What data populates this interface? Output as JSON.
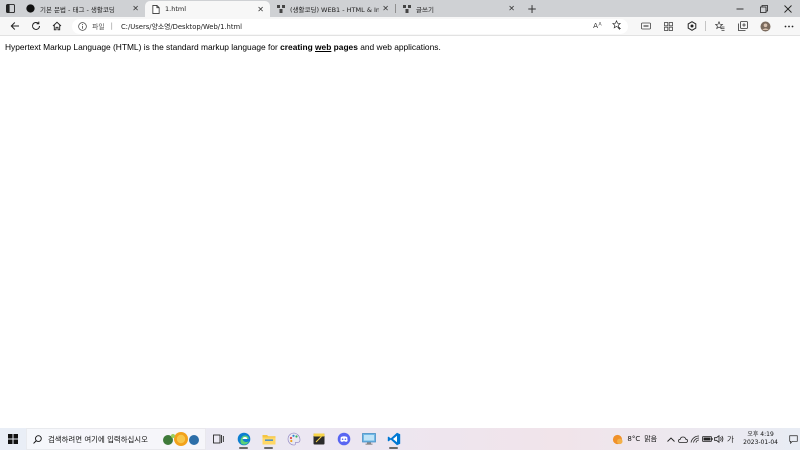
{
  "browser": {
    "tabs": [
      {
        "title": "기본 문법 - 태그 - 생활코딩",
        "icon": "github-icon",
        "active": false
      },
      {
        "title": "1.html",
        "icon": "file-icon",
        "active": true
      },
      {
        "title": "(생활코딩) WEB1 - HTML & Inter",
        "icon": "opentutorials-icon",
        "active": false
      },
      {
        "title": "글쓰기",
        "icon": "opentutorials-icon",
        "active": false
      }
    ],
    "close_glyph": "✕",
    "new_tab_glyph": "+",
    "address": {
      "scheme_label": "파일",
      "divider": "|",
      "url": "C:/Users/양소영/Desktop/Web/1.html"
    }
  },
  "page": {
    "text_before": "Hypertext Markup Language (HTML) is the standard markup language for ",
    "bold_1": "creating",
    "space_1": " ",
    "underline_bold": "web",
    "space_2": " ",
    "bold_2": "pages",
    "text_after": " and web applications."
  },
  "taskbar": {
    "search_placeholder": "검색하려면 여기에 입력하십시오",
    "weather_temp": "8°C",
    "weather_desc": "맑음",
    "clock_time": "오후 4:19",
    "clock_date": "2023-01-04"
  },
  "colors": {
    "tabstrip_bg": "#cfd1d4",
    "toolbar_bg": "#f7f7f7",
    "edge_blue": "#0c7fd1",
    "vscode_blue": "#0078d4",
    "discord": "#5865f2"
  }
}
